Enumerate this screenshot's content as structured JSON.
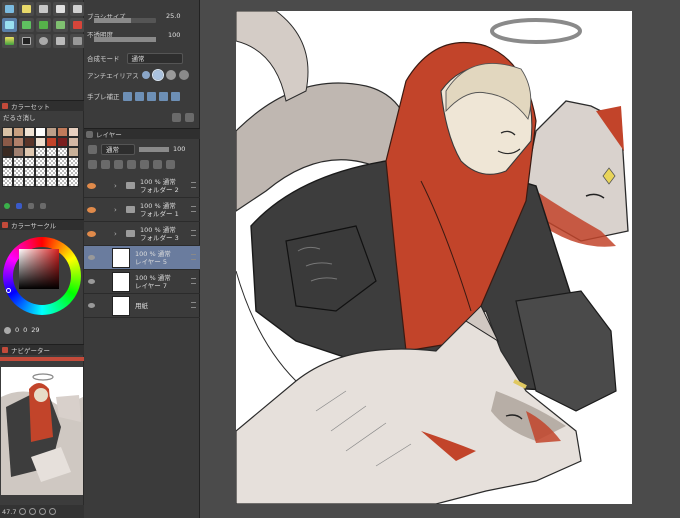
{
  "brush_size": {
    "label": "ブラシサイズ",
    "value": "25.0",
    "fraction": 0.6
  },
  "opacity": {
    "label": "不透明度",
    "value": "100",
    "fraction": 1.0
  },
  "blend_mode": {
    "label": "合成モード",
    "value": "通常"
  },
  "antialias": {
    "label": "アンチエイリアス"
  },
  "stabilizer": {
    "label": "手ブレ補正"
  },
  "color_set": {
    "title": "カラーセット",
    "palette_name": "だるさ消し"
  },
  "color_circle": {
    "title": "カラーサークル",
    "readout": [
      "0",
      "0",
      "29"
    ]
  },
  "navigator": {
    "title": "ナビゲーター",
    "zoom": "47.7"
  },
  "layer_panel": {
    "title": "レイヤー",
    "blend": "通常",
    "opacity": "100",
    "layers": [
      {
        "line1": "100 % 通常",
        "line2": "フォルダー 2",
        "kind": "folder",
        "visible": true,
        "active": false
      },
      {
        "line1": "100 % 通常",
        "line2": "フォルダー 1",
        "kind": "folder",
        "visible": true,
        "active": false
      },
      {
        "line1": "100 % 通常",
        "line2": "フォルダー 3",
        "kind": "folder",
        "visible": true,
        "active": false
      },
      {
        "line1": "100 % 通常",
        "line2": "レイヤー 5",
        "kind": "raster",
        "visible": true,
        "active": true
      },
      {
        "line1": "100 % 通常",
        "line2": "レイヤー 7",
        "kind": "raster",
        "visible": true,
        "active": false
      },
      {
        "line1": "",
        "line2": "用紙",
        "kind": "paper",
        "visible": true,
        "active": false
      }
    ]
  },
  "colors": {
    "accent_active_layer": "#6a7c9e",
    "eye_icon": "#e08a4a",
    "hoodie_red": "#c2442a",
    "jacket_dark": "#3d3d3d",
    "fox_gray": "#b7aea6"
  }
}
